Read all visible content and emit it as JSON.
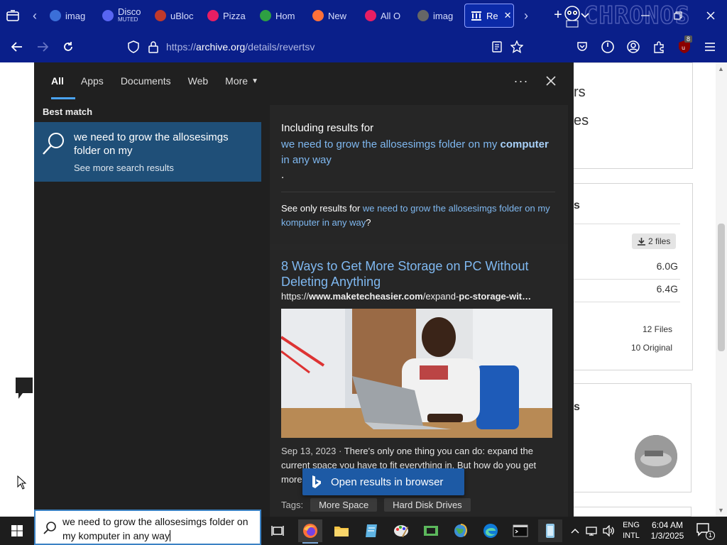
{
  "browser": {
    "tabs": [
      {
        "label": "imag",
        "sub": "",
        "color": "#3b6fd8"
      },
      {
        "label": "Disco",
        "sub": "MUTED",
        "color": "#5865f2"
      },
      {
        "label": "uBloc",
        "sub": "",
        "color": "#c0392b"
      },
      {
        "label": "Pizza",
        "sub": "",
        "color": "#e81e63"
      },
      {
        "label": "Hom",
        "sub": "",
        "color": "#2ea043"
      },
      {
        "label": "New",
        "sub": "",
        "color": "#ff7139"
      },
      {
        "label": "All O",
        "sub": "",
        "color": "#e81e63"
      },
      {
        "label": "imag",
        "sub": "",
        "color": "#666666"
      }
    ],
    "active_tab": {
      "label": "Re",
      "color": "#ffffff"
    },
    "brand_text": "CHRONOS",
    "url_prefix": "https://",
    "url_host": "archive.org",
    "url_path": "/details/revertsv",
    "extension_badge": "8"
  },
  "page_behind": {
    "fragment_1": "rs",
    "fragment_2": "es",
    "section_heading": "s",
    "files_button": "2 files",
    "size_1": "6.0G",
    "size_2": "6.4G",
    "files_count": "12 Files",
    "original_count": "10 Original",
    "section_heading_2": "s"
  },
  "search_flyout": {
    "tabs": [
      {
        "label": "All",
        "active": true
      },
      {
        "label": "Apps",
        "active": false
      },
      {
        "label": "Documents",
        "active": false
      },
      {
        "label": "Web",
        "active": false
      },
      {
        "label": "More",
        "active": false
      }
    ],
    "more_options": "···",
    "best_match_label": "Best match",
    "best_match": {
      "title": "we need to grow the allosesimgs folder on my",
      "subtitle": "See more search results"
    },
    "including": {
      "heading": "Including results for",
      "query_start": "we need to grow the allosesimgs folder on my",
      "query_bold": "computer",
      "query_end": "in any way",
      "dot": ".",
      "only_prefix": "See only results for",
      "only_link": "we need to grow the allosesimgs folder on my komputer in any way",
      "only_suffix": "?"
    },
    "result": {
      "title": "8 Ways to Get More Storage on PC Without Deleting Anything",
      "url_prefix": "https://",
      "url_bold": "www.maketecheasier.com",
      "url_mid": "/expand-",
      "url_bold_2": "pc-storage-wit…",
      "date": "Sep 13, 2023 ·",
      "snippet": "There's only one thing you can do: expand the current space you have to fit everything in. But how do you get more PC",
      "snippet_tail": "...",
      "tags_label": "Tags:",
      "tags": [
        "More Space",
        "Hard Disk Drives"
      ]
    },
    "open_browser_button": "Open results in browser"
  },
  "taskbar": {
    "search_value": "we need to grow the allosesimgs folder on my komputer in any way",
    "language_line1": "ENG",
    "language_line2": "INTL",
    "time": "6:04 AM",
    "date": "1/3/2025",
    "notification_count": "1"
  },
  "colors": {
    "browser_chrome": "#0a1f8a",
    "flyout_bg": "#202020",
    "best_match_bg": "#1f4f78",
    "link_blue": "#7fb8f0",
    "open_button": "#1d5aa5",
    "taskbar_bg": "#1d1d1d"
  }
}
